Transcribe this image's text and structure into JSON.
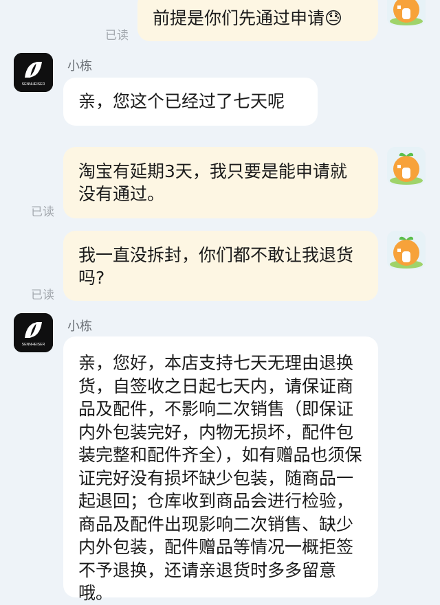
{
  "messages": [
    {
      "from": "me",
      "text": "前提是你们先通过申请😓",
      "status": "已读"
    },
    {
      "from": "shop",
      "sender": "小栋",
      "text": "亲，您这个已经过了七天呢"
    },
    {
      "from": "me",
      "text": "淘宝有延期3天，我只要是能申请就没有通过。",
      "status": "已读"
    },
    {
      "from": "me",
      "text": "我一直没拆封，你们都不敢让我退货吗?",
      "status": "已读"
    },
    {
      "from": "shop",
      "sender": "小栋",
      "text": "亲，您好，本店支持七天无理由退换货，自签收之日起七天内，请保证商品及配件，不影响二次销售（即保证内外包装完好，内物无损坏，配件包装完整和配件齐全），如有赠品也须保证完好没有损坏缺少包装，随商品一起退回；仓库收到商品会进行检验，商品及配件出现影响二次销售、缺少内外包装，配件赠品等情况一概拒签不予退换，还请亲退货时多多留意哦。"
    }
  ],
  "shop_logo_text": "SENNHEISER",
  "colors": {
    "background": "#eef3f8",
    "outgoing_bubble": "#fdf6e3",
    "incoming_bubble": "#ffffff",
    "read_label": "#a3a8ae"
  }
}
